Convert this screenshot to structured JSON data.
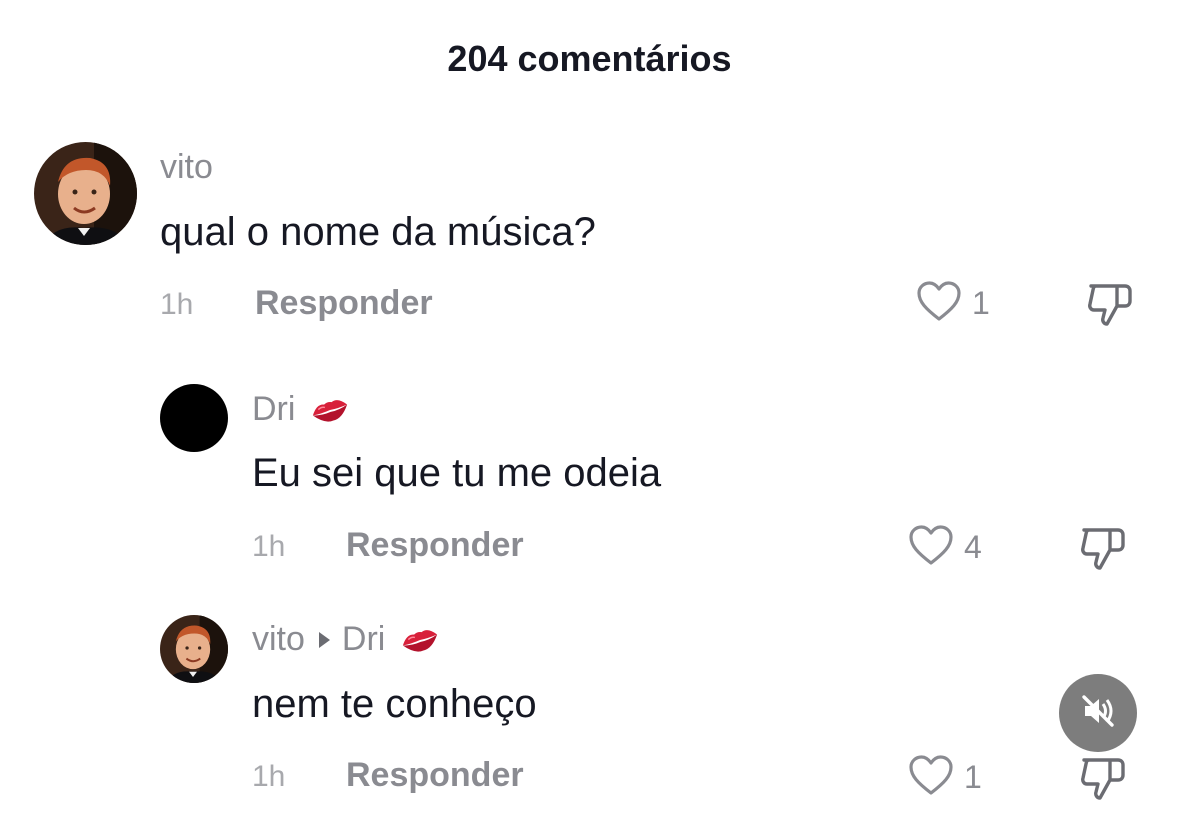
{
  "header": {
    "title": "204 comentários"
  },
  "comments": [
    {
      "user": "vito",
      "text": "qual o nome da música?",
      "time": "1h",
      "reply_label": "Responder",
      "likes": "1"
    },
    {
      "user": "Dri",
      "text": "Eu sei que tu me odeia",
      "time": "1h",
      "reply_label": "Responder",
      "likes": "4"
    },
    {
      "user": "vito",
      "reply_to": "Dri",
      "text": "nem te conheço",
      "time": "1h",
      "reply_label": "Responder",
      "likes": "1"
    }
  ],
  "icons": {
    "heart": "heart-outline-icon",
    "dislike": "thumbs-down-icon",
    "lips": "kiss-mark-icon",
    "mute": "speaker-muted-icon"
  },
  "colors": {
    "text_primary": "#161823",
    "text_secondary": "#8a8b91",
    "mute_button": "#7d7d7d"
  }
}
